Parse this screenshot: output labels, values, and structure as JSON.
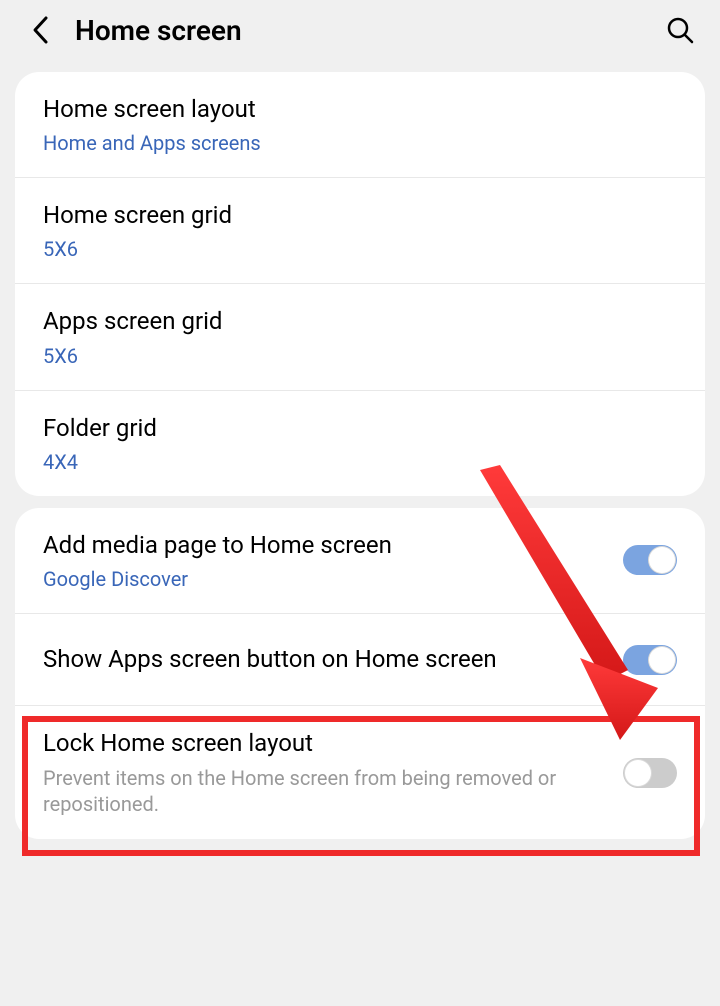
{
  "header": {
    "title": "Home screen"
  },
  "group1": {
    "layout": {
      "title": "Home screen layout",
      "subtitle": "Home and Apps screens"
    },
    "home_grid": {
      "title": "Home screen grid",
      "subtitle": "5X6"
    },
    "apps_grid": {
      "title": "Apps screen grid",
      "subtitle": "5X6"
    },
    "folder_grid": {
      "title": "Folder grid",
      "subtitle": "4X4"
    }
  },
  "group2": {
    "media_page": {
      "title": "Add media page to Home screen",
      "subtitle": "Google Discover",
      "toggle": true
    },
    "show_apps": {
      "title": "Show Apps screen button on Home screen",
      "toggle": true
    },
    "lock_layout": {
      "title": "Lock Home screen layout",
      "description": "Prevent items on the Home screen from being removed or repositioned.",
      "toggle": false
    }
  },
  "annotation": {
    "highlight_color": "#ef2a2a"
  }
}
